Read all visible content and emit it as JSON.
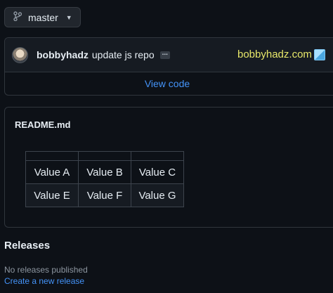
{
  "branch": {
    "name": "master",
    "icon": "git-branch-icon"
  },
  "commit": {
    "author": "bobbyhadz",
    "message": "update js repo",
    "ellipsis": "...",
    "brand_text": "bobbyhadz.com",
    "view_code_label": "View code"
  },
  "readme": {
    "title": "README.md",
    "table": {
      "rows": [
        [
          "Value A",
          "Value B",
          "Value C"
        ],
        [
          "Value E",
          "Value F",
          "Value G"
        ]
      ]
    }
  },
  "releases": {
    "title": "Releases",
    "empty_text": "No releases published",
    "create_link": "Create a new release"
  },
  "colors": {
    "background": "#0d1117",
    "link": "#4493f8",
    "brand": "#e8e86a"
  }
}
